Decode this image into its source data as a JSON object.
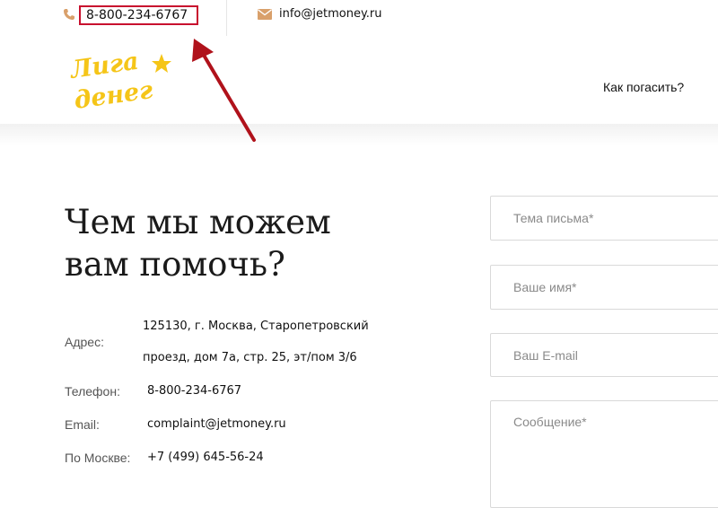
{
  "topbar": {
    "phone": "8-800-234-6767",
    "email": "info@jetmoney.ru",
    "phone_icon": "phone-icon",
    "mail_icon": "mail-icon"
  },
  "header": {
    "logo_text_line1": "Лига",
    "logo_text_line2": "денег",
    "nav_link": "Как погасить?"
  },
  "colors": {
    "accent_gold": "#f5c518",
    "icon_tan": "#d9a06b",
    "highlight_red": "#c8102e"
  },
  "contact": {
    "title_line1": "Чем мы можем",
    "title_line2": "вам помочь?",
    "address_label": "Адрес:",
    "address_line1": "125130, г. Москва, Старопетровский",
    "address_line2": "проезд, дом 7а, стр. 25, эт/пом 3/6",
    "phone_label": "Телефон:",
    "phone_value": "8-800-234-6767",
    "email_label": "Email:",
    "email_value": "complaint@jetmoney.ru",
    "moscow_label": "По Москве:",
    "moscow_value": "+7 (499) 645-56-24"
  },
  "form": {
    "subject_placeholder": "Тема письма*",
    "name_placeholder": "Ваше имя*",
    "email_placeholder": "Ваш E-mail",
    "message_placeholder": "Сообщение*"
  }
}
